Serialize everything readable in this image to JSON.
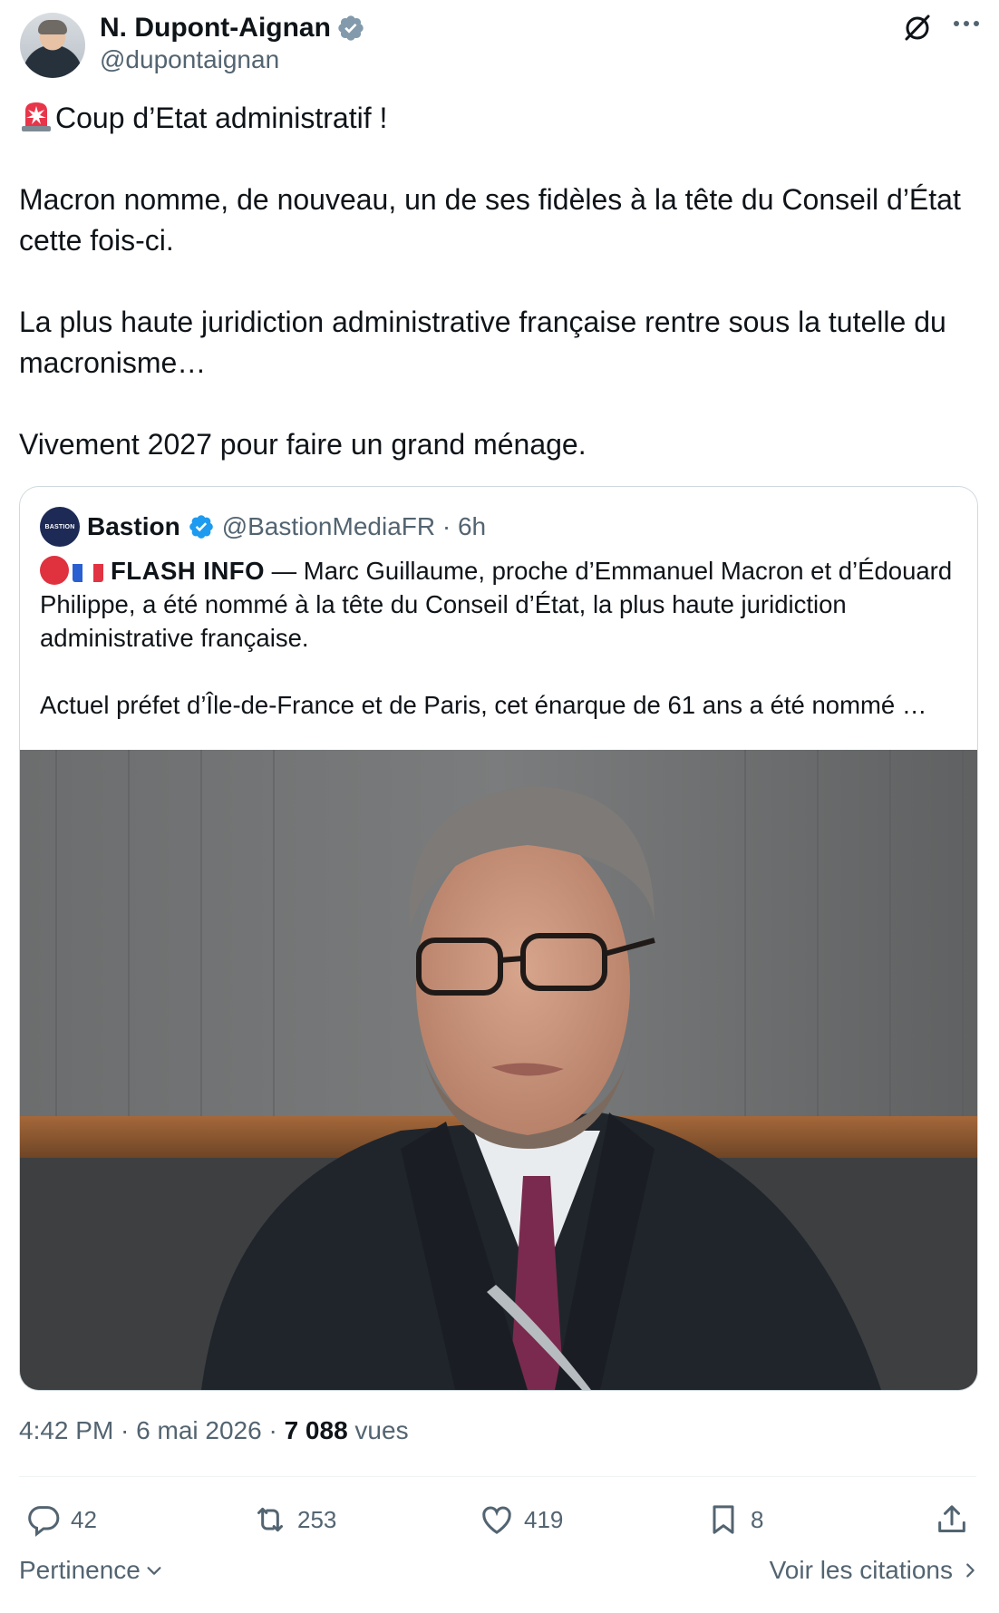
{
  "author": {
    "name": "N. Dupont-Aignan",
    "handle": "@dupontaignan",
    "verified_badge": "gray-verified-icon"
  },
  "header_icons": [
    "grok-icon",
    "more-icon"
  ],
  "tweet": {
    "line1": "Coup d’Etat administratif !",
    "line2": "Macron nomme, de nouveau, un de ses fidèles à la tête du Conseil d’État cette fois-ci.",
    "line3": "La plus haute juridiction administrative française rentre sous la tutelle du macronisme…",
    "line4": "Vivement 2027 pour faire un grand ménage.",
    "emoji": "siren-icon"
  },
  "quote": {
    "avatar_text": "BASTION",
    "name": "Bastion",
    "handle_time": "@BastionMediaFR · 6h",
    "flash_label": "FLASH INFO",
    "para1": " — Marc Guillaume, proche d’Emmanuel Macron et d’Édouard Philippe, a été nommé à la tête du Conseil d’État, la plus haute juridiction administrative française.",
    "para2": "Actuel préfet d’Île-de-France et de Paris, cet énarque de 61 ans a été nommé …",
    "image": "man-portrait-photo"
  },
  "meta": {
    "time_date": "4:42 PM · 6 mai 2026 · ",
    "views_count": "7 088",
    "views_label": " vues"
  },
  "actions": {
    "replies": "42",
    "reposts": "253",
    "likes": "419",
    "bookmarks": "8"
  },
  "footer": {
    "sort_label": "Pertinence",
    "quotes_link": "Voir les citations"
  },
  "colors": {
    "text": "#0f1419",
    "secondary": "#536471",
    "border": "#cfd9de",
    "verified_blue": "#1d9bf0",
    "verified_gray": "#829aab"
  }
}
